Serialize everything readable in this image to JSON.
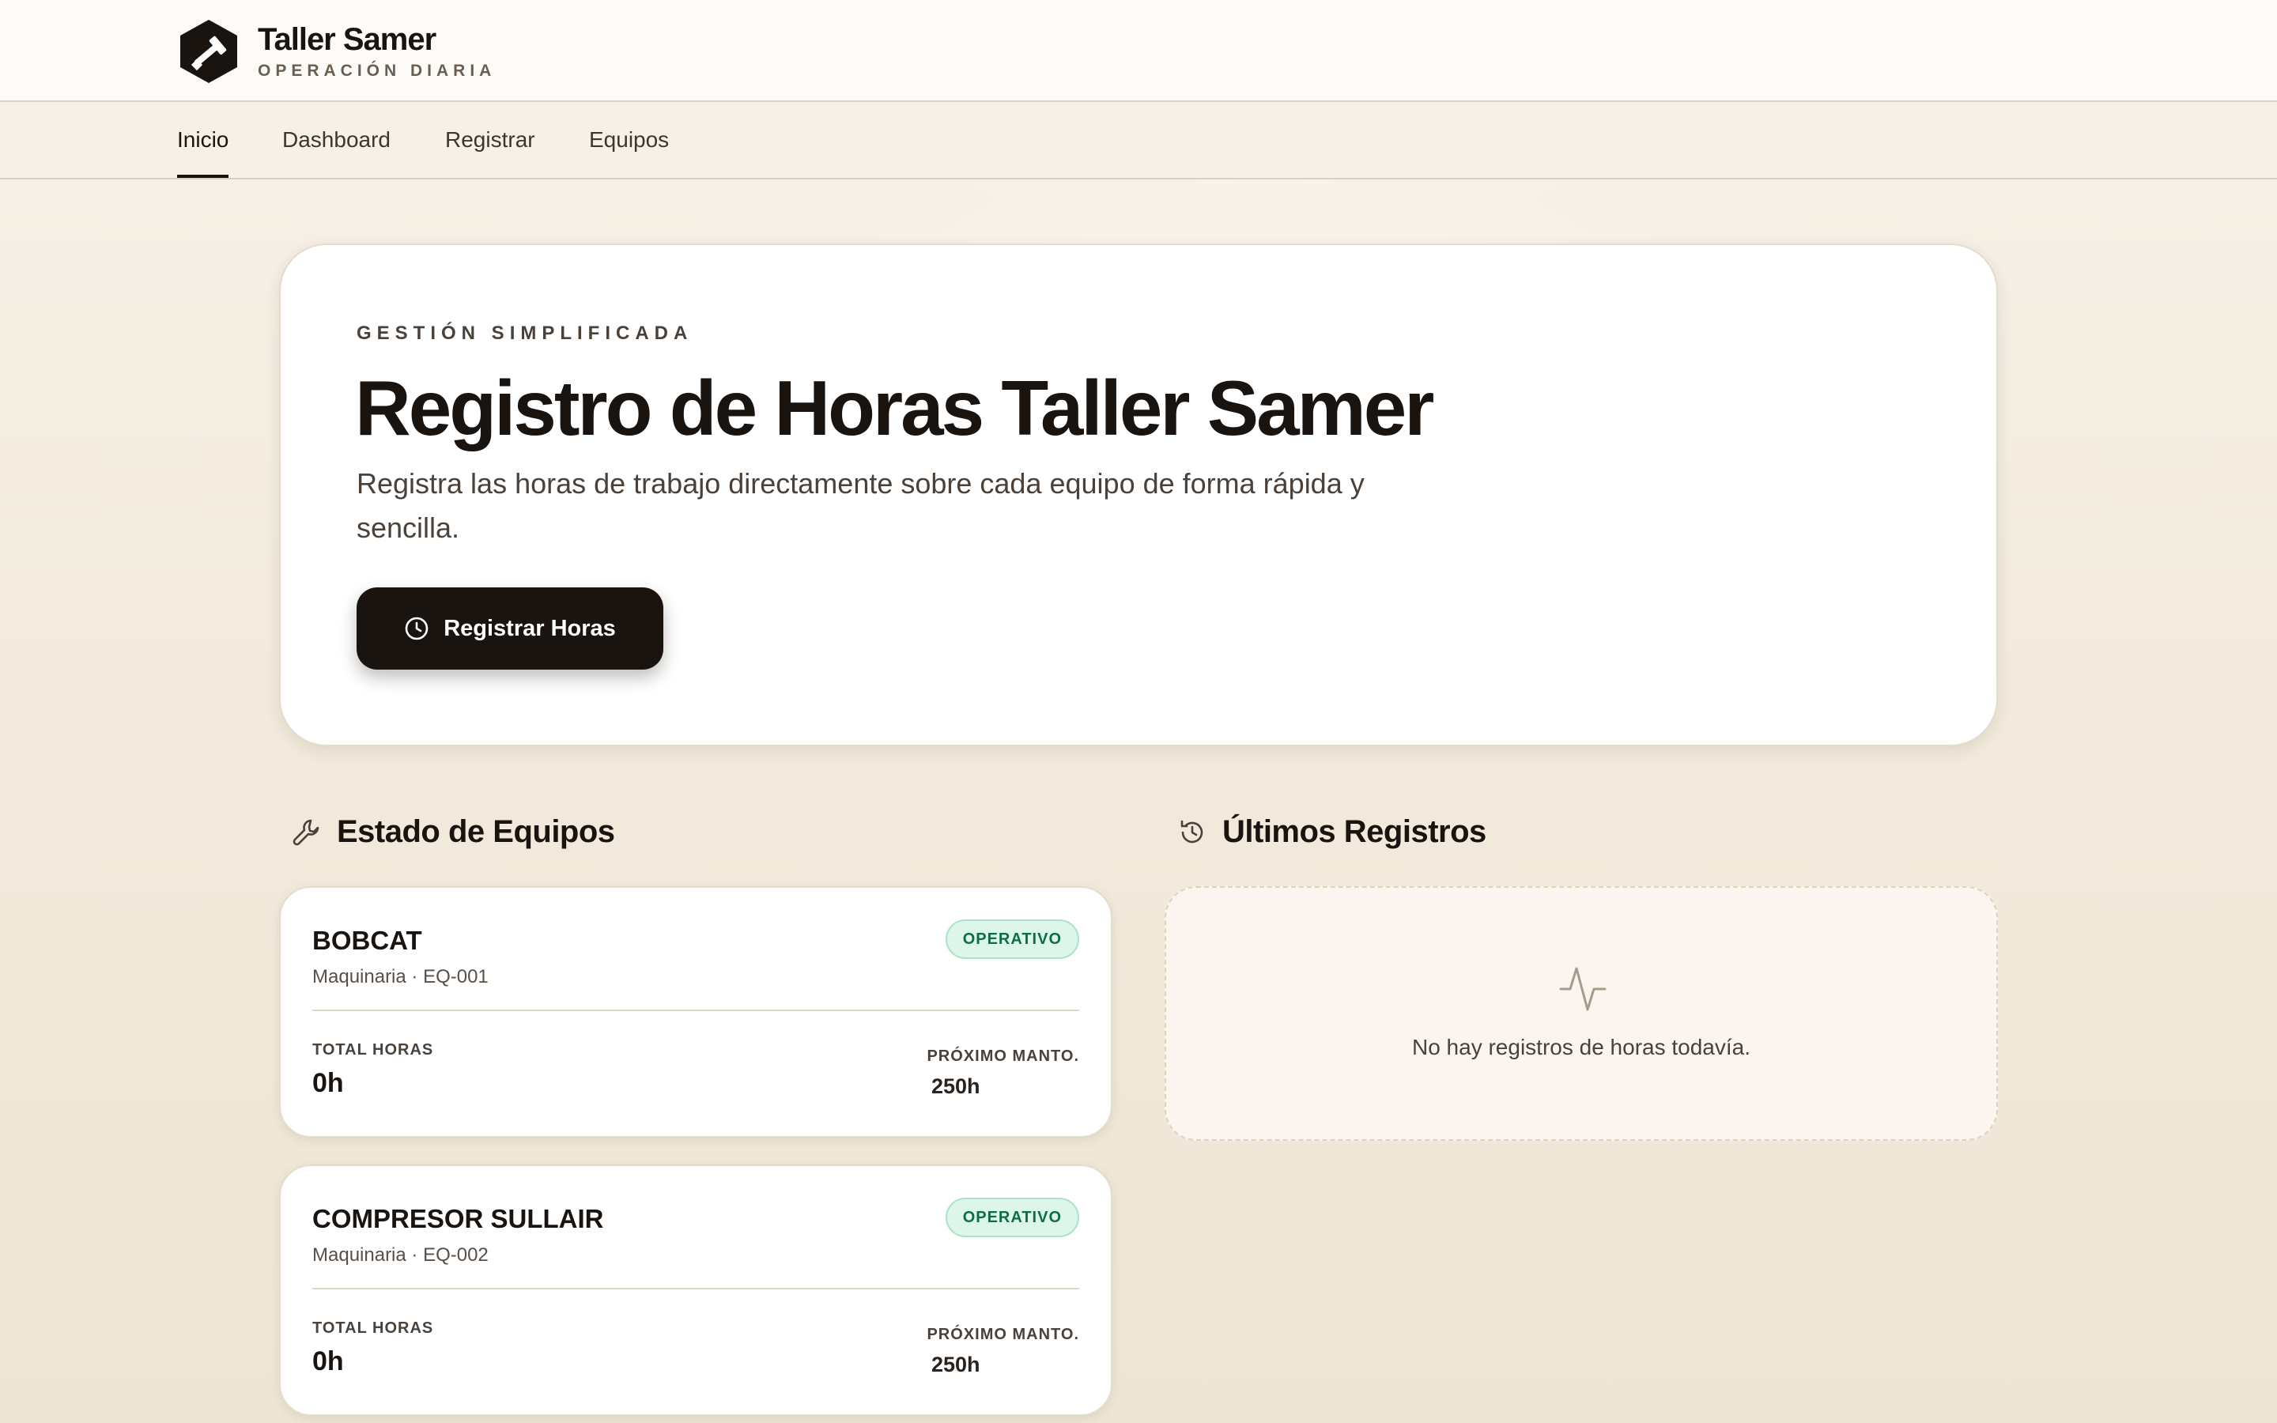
{
  "brand": {
    "name": "Taller Samer",
    "subtitle": "OPERACIÓN DIARIA",
    "logo_icon": "hammer-hex-logo"
  },
  "nav": {
    "items": [
      {
        "label": "Inicio",
        "active": true
      },
      {
        "label": "Dashboard",
        "active": false
      },
      {
        "label": "Registrar",
        "active": false
      },
      {
        "label": "Equipos",
        "active": false
      }
    ]
  },
  "hero": {
    "kicker": "GESTIÓN SIMPLIFICADA",
    "title": "Registro de Horas Taller Samer",
    "description": "Registra las horas de trabajo directamente sobre cada equipo de forma rápida y sencilla.",
    "button_label": "Registrar Horas",
    "button_icon": "clock-icon"
  },
  "equipment_section": {
    "title": "Estado de Equipos",
    "icon": "wrench-icon",
    "items": [
      {
        "name": "BOBCAT",
        "meta": "Maquinaria · EQ-001",
        "status": "OPERATIVO",
        "total_label": "TOTAL HORAS",
        "total_value": "0h",
        "next_label": "PRÓXIMO MANTO.",
        "next_value": "250h"
      },
      {
        "name": "COMPRESOR SULLAIR",
        "meta": "Maquinaria · EQ-002",
        "status": "OPERATIVO",
        "total_label": "TOTAL HORAS",
        "total_value": "0h",
        "next_label": "PRÓXIMO MANTO.",
        "next_value": "250h"
      }
    ]
  },
  "records_section": {
    "title": "Últimos Registros",
    "icon": "history-icon",
    "empty_icon": "activity-pulse-icon",
    "empty_text": "No hay registros de horas todavía."
  },
  "colors": {
    "accent_dark": "#1a1411",
    "status_operativo_bg": "#dcf6ea",
    "status_operativo_text": "#0f6b4e",
    "background": "#f3ebdf"
  }
}
